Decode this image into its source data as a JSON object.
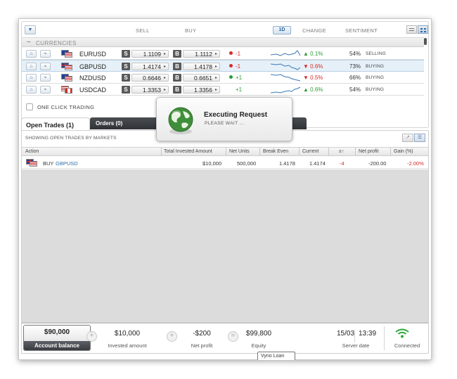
{
  "currencies_panel": {
    "columns": {
      "sell": "SELL",
      "buy": "BUY",
      "period": "1D",
      "change": "CHANGE",
      "sentiment": "SENTIMENT"
    },
    "filter_icon": "filter-icon",
    "section_title": "CURRENCIES",
    "rows": [
      {
        "pair": "EURUSD",
        "flag_a": "eu-flag",
        "flag_b": "us-flag",
        "sell_tag": "S",
        "sell": "1.1109",
        "buy_tag": "B",
        "buy": "1.1112",
        "spread": "-1",
        "spread_color": "#d9292b",
        "change": "0.1%",
        "change_dir": "up",
        "change_color": "#2e9a3a",
        "sentiment_pct": "54%",
        "sentiment": "SELLING",
        "trend": "up"
      },
      {
        "pair": "GBPUSD",
        "flag_a": "uk-flag",
        "flag_b": "us-flag",
        "sell_tag": "S",
        "sell": "1.4174",
        "buy_tag": "B",
        "buy": "1.4178",
        "spread": "-1",
        "spread_color": "#d9292b",
        "change": "0.6%",
        "change_dir": "down",
        "change_color": "#d9292b",
        "sentiment_pct": "73%",
        "sentiment": "BUYING",
        "trend": "down"
      },
      {
        "pair": "NZDUSD",
        "flag_a": "nz-flag",
        "flag_b": "us-flag",
        "sell_tag": "S",
        "sell": "0.6646",
        "buy_tag": "B",
        "buy": "0.6651",
        "spread": "+1",
        "spread_color": "#2e9a3a",
        "change": "0.5%",
        "change_dir": "down",
        "change_color": "#d9292b",
        "sentiment_pct": "66%",
        "sentiment": "BUYING",
        "trend": "down"
      },
      {
        "pair": "USDCAD",
        "flag_a": "us-flag",
        "flag_b": "ca-flag",
        "sell_tag": "S",
        "sell": "1.3353",
        "buy_tag": "B",
        "buy": "1.3356",
        "spread": "+1",
        "spread_color": "#2e9a3a",
        "change": "0.6%",
        "change_dir": "up",
        "change_color": "#2e9a3a",
        "sentiment_pct": "54%",
        "sentiment": "BUYING",
        "trend": "up"
      }
    ],
    "one_click_label": "ONE CLICK TRADING"
  },
  "tabs": {
    "open_trades": "Open Trades (1)",
    "orders": "Orders (0)"
  },
  "trades": {
    "showing_label": "SHOWING OPEN TRADES BY MARKETS",
    "headers": {
      "action": "Action",
      "total_invested": "Total Invested Amount",
      "net_units": "Net Units",
      "break_even": "Break Even",
      "current": "Current",
      "pips": "±↑",
      "net_profit": "Net profit",
      "gain": "Gain (%)"
    },
    "row": {
      "flag": "uk-flag",
      "action": "BUY",
      "pair": "GBPUSD",
      "total_invested": "$10,000",
      "net_units": "500,000",
      "break_even": "1.4178",
      "current": "1.4174",
      "pips": "-4",
      "net_profit": "-200.00",
      "gain": "-2.00%"
    }
  },
  "footer": {
    "account_balance_value": "$90,000",
    "account_balance_label": "Account balance",
    "op_plus_1": "+",
    "invested_value": "$10,000",
    "invested_label": "Invested amount",
    "op_plus_2": "+",
    "net_profit_value": "-$200",
    "net_profit_label": "Net profit",
    "op_equals": "=",
    "equity_value": "$99,800",
    "equity_label": "Equity",
    "server_date": "15/03",
    "server_time": "13:39",
    "server_date_label": "Server date",
    "connection_label": "Connected",
    "connection_color": "#2fa83c",
    "tooltip_text": "Vyno Loan"
  },
  "overlay": {
    "title": "Executing Request",
    "subtitle": "PLEASE WAIT ...",
    "icon": "globe-icon"
  },
  "colors": {
    "negative": "#d9292b",
    "positive": "#2e9a3a",
    "link": "#2c6da8"
  }
}
